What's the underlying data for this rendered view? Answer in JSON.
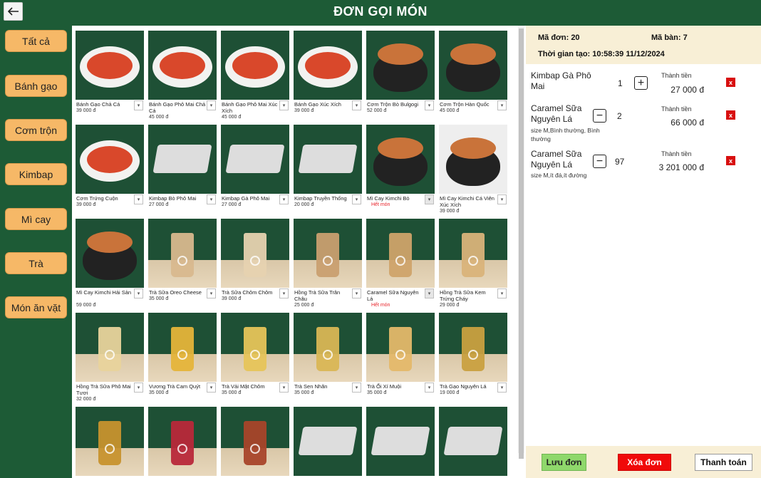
{
  "header": {
    "title": "ĐƠN GỌI MÓN",
    "back_icon": "arrow-left-icon"
  },
  "categories": [
    "Tất cả",
    "Bánh gạo",
    "Cơm trộn",
    "Kimbap",
    "Mì cay",
    "Trà",
    "Món ăn vặt"
  ],
  "products": [
    {
      "name": "Bánh Gạo Chả Cá",
      "price": "39 000 đ",
      "img": "plate"
    },
    {
      "name": "Bánh Gạo Phô Mai Chả Cá",
      "price": "45 000 đ",
      "img": "plate"
    },
    {
      "name": "Bánh Gạo Phô Mai Xúc Xích",
      "price": "45 000 đ",
      "img": "plate"
    },
    {
      "name": "Bánh Gạo Xúc Xích",
      "price": "39 000 đ",
      "img": "plate"
    },
    {
      "name": "Cơm Trộn Bò Bulgogi",
      "price": "52 000 đ",
      "img": "bowl"
    },
    {
      "name": "Cơm Trộn Hàn Quốc",
      "price": "45 000 đ",
      "img": "bowl"
    },
    {
      "name": "Cơm Trứng Cuộn",
      "price": "39 000 đ",
      "img": "plate"
    },
    {
      "name": "Kimbap Bò Phô Mai",
      "price": "27 000 đ",
      "img": "tray"
    },
    {
      "name": "Kimbap Gà Phô Mai",
      "price": "27 000 đ",
      "img": "tray"
    },
    {
      "name": "Kimbap Truyền Thống",
      "price": "20 000 đ",
      "img": "tray"
    },
    {
      "name": "Mì Cay Kimchi Bò",
      "price": "",
      "sold": "Hết món",
      "img": "bowl"
    },
    {
      "name": "Mì Cay Kimchi Cá Viên Xúc Xích",
      "price": "39 000 đ",
      "img": "bowl",
      "light": true
    },
    {
      "name": "Mì Cay Kimchi Hải Sản",
      "price": "59 000 đ",
      "img": "bowl"
    },
    {
      "name": "Trà Sữa Oreo Cheese",
      "price": "35 000 đ",
      "img": "drink",
      "cup": "#d8b88e"
    },
    {
      "name": "Trà Sữa Chôm Chôm",
      "price": "39 000 đ",
      "img": "drink",
      "cup": "#e6d2b0"
    },
    {
      "name": "Hồng Trà Sữa Trân Châu",
      "price": "25 000 đ",
      "img": "drink",
      "cup": "#c99f70"
    },
    {
      "name": "Caramel Sữa Nguyên Lá",
      "price": "",
      "sold": "Hết món",
      "img": "drink",
      "cup": "#cfa36a"
    },
    {
      "name": "Hồng Trà Sữa Kem Trứng Cháy",
      "price": "29 000 đ",
      "img": "drink",
      "cup": "#d9b37a"
    },
    {
      "name": "Hồng Trà Sữa Phô Mai Tươi",
      "price": "32 000 đ",
      "img": "drink",
      "cup": "#e8d39c"
    },
    {
      "name": "Vương Trà Cam Quýt",
      "price": "35 000 đ",
      "img": "drink",
      "cup": "#e5b43a"
    },
    {
      "name": "Trà Vải Mật Chôm",
      "price": "35 000 đ",
      "img": "drink",
      "cup": "#e6c45a"
    },
    {
      "name": "Trà Sen Nhãn",
      "price": "35 000 đ",
      "img": "drink",
      "cup": "#d9b655"
    },
    {
      "name": "Trà Ổi Xí Muội",
      "price": "35 000 đ",
      "img": "drink",
      "cup": "#e4b86a"
    },
    {
      "name": "Trà Gạo Nguyên Lá",
      "price": "19 000 đ",
      "img": "drink",
      "cup": "#c9a040"
    },
    {
      "name": "",
      "price": "",
      "img": "drink",
      "cup": "#c7922e"
    },
    {
      "name": "",
      "price": "",
      "img": "drink",
      "cup": "#b8283a"
    },
    {
      "name": "",
      "price": "",
      "img": "drink",
      "cup": "#a8452a"
    },
    {
      "name": "",
      "price": "",
      "img": "tray"
    },
    {
      "name": "",
      "price": "",
      "img": "tray"
    },
    {
      "name": "",
      "price": "",
      "img": "tray"
    }
  ],
  "order": {
    "order_id_label": "Mã đơn: 20",
    "table_label": "Mã bàn: 7",
    "created_label": "Thời gian tạo: 10:58:39 11/12/2024",
    "total_label": "Thành tiền",
    "items": [
      {
        "name": "Kimbap Gà Phô Mai",
        "note": "",
        "qty": "1",
        "total": "27 000 đ"
      },
      {
        "name": "Caramel Sữa Nguyên Lá",
        "note": "size M,Bình thường, Bình thường",
        "qty": "2",
        "total": "66 000 đ"
      },
      {
        "name": "Caramel Sữa Nguyên Lá",
        "note": "size M,ít đá,ít đường",
        "qty": "97",
        "total": "3 201 000 đ"
      }
    ],
    "delete_symbol": "x",
    "plus_symbol": "+",
    "minus_symbol": "−"
  },
  "footer": {
    "save_label": "Lưu đơn",
    "delete_label": "Xóa đơn",
    "pay_label": "Thanh toán"
  },
  "colors": {
    "brand_green": "#1d5b36",
    "category_orange": "#f6b867",
    "sold_out_red": "#e8232a",
    "panel_cream": "#f8efd6"
  }
}
